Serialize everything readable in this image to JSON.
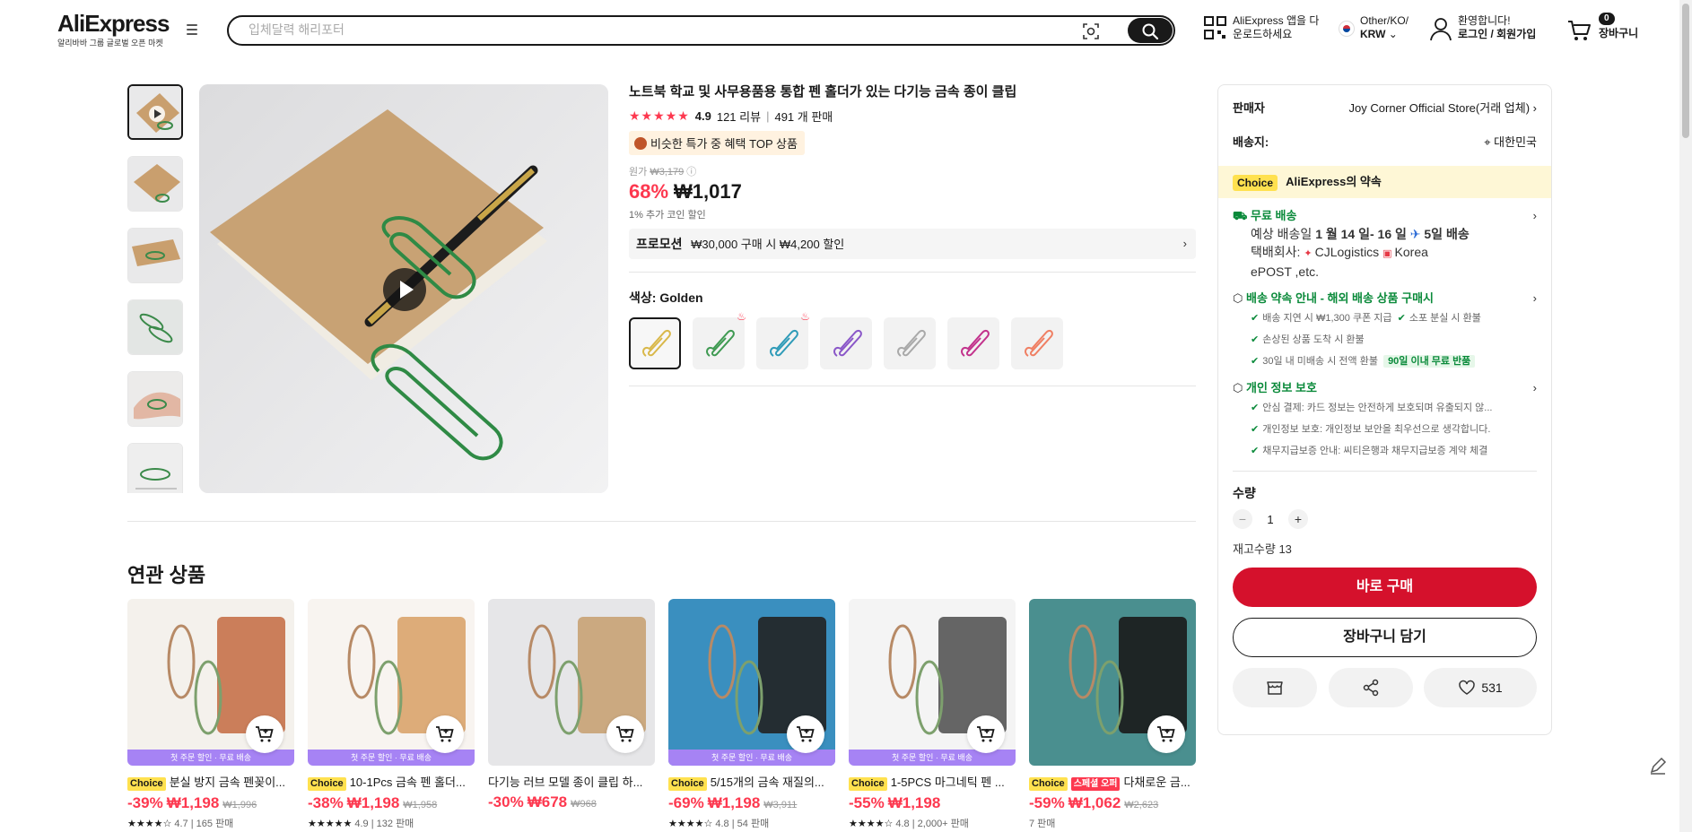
{
  "header": {
    "logo": "AliExpress",
    "logo_sub": "알리바바 그룹 글로벌 오픈 마켓",
    "search_placeholder": "입체달력 해리포터",
    "app_line1": "AliExpress 앱을 다",
    "app_line2": "운로드하세요",
    "region_line1": "Other/KO/",
    "region_line2": "KRW",
    "account_line1": "환영합니다!",
    "account_line2": "로그인 / 회원가입",
    "cart_count": "0",
    "cart_label": "장바구니"
  },
  "product": {
    "title": "노트북 학교 및 사무용품용 통합 펜 홀더가 있는 다기능 금속 종이 클립",
    "rating": "4.9",
    "reviews": "121 리뷰",
    "sold": "491 개 판매",
    "deal_badge": "비슷한 특가 중 혜택 TOP 상품",
    "orig_label": "원가",
    "orig_price": "₩3,179",
    "discount": "68%",
    "price": "₩1,017",
    "coin_discount": "1% 추가 코인 할인",
    "promo_label": "프로모션",
    "promo_text": "₩30,000 구매 시 ₩4,200 할인",
    "color_label": "색상:",
    "color_value": "Golden",
    "swatch_colors": [
      "#d9b84a",
      "#3f9a52",
      "#2f9bb8",
      "#8a57c8",
      "#a9a9a9",
      "#c2328c",
      "#ef7f63"
    ]
  },
  "panel": {
    "seller_label": "판매자",
    "seller_value": "Joy Corner Official Store(거래 업체)",
    "ship_to_label": "배송지:",
    "ship_to_value": "대한민국",
    "choice_tag": "Choice",
    "choice_text": "AliExpress의 약속",
    "free_ship": "무료 배송",
    "eta_prefix": "예상 배송일",
    "eta_range": "1 월 14 일- 16 일",
    "eta_fast": "5일 배송",
    "carrier_label": "택배회사:",
    "carrier_line1": "CJLogistics",
    "carrier_line2": "Korea",
    "carrier_line3": "ePOST ,etc.",
    "promise_head": "배송 약속 안내 - 해외 배송 상품 구매시",
    "promise_1": "배송 지연 시 ₩1,300 쿠폰 지급",
    "promise_2": "소포 분실 시 환불",
    "promise_3": "손상된 상품 도착 시 환불",
    "promise_4": "30일 내 미배송 시 전액 환불",
    "promise_4_badge": "90일 이내 무료 반품",
    "privacy_head": "개인 정보 보호",
    "privacy_1": "안심 결제: 카드 정보는 안전하게 보호되며 유출되지 않...",
    "privacy_2": "개인정보 보호: 개인정보 보안을 최우선으로 생각합니다.",
    "privacy_3": "채무지급보증 안내: 씨티은행과 채무지급보증 계약 체결",
    "qty_label": "수량",
    "qty_value": "1",
    "stock": "재고수량 13",
    "buy_now": "바로 구매",
    "add_cart": "장바구니 담기",
    "wish_count": "531"
  },
  "related": {
    "title": "연관 상품",
    "strip": "첫 주문 할인 · 무료 배송",
    "items": [
      {
        "tag": "Choice",
        "name": "분실 방지 금속 펜꽂이...",
        "discount": "-39%",
        "price": "₩1,198",
        "orig": "₩1,996",
        "stars": "★★★★☆",
        "rating": "4.7",
        "sold": "165 판매",
        "strip": true
      },
      {
        "tag": "Choice",
        "name": "10-1Pcs 금속 펜 홀더...",
        "discount": "-38%",
        "price": "₩1,198",
        "orig": "₩1,958",
        "stars": "★★★★★",
        "rating": "4.9",
        "sold": "132 판매",
        "strip": true
      },
      {
        "tag": "",
        "name": "다기능 러브 모델 종이 클립 하...",
        "discount": "-30%",
        "price": "₩678",
        "orig": "₩968",
        "stars": "",
        "rating": "",
        "sold": "",
        "strip": false
      },
      {
        "tag": "Choice",
        "name": "5/15개의 금속 재질의...",
        "discount": "-69%",
        "price": "₩1,198",
        "orig": "₩3,911",
        "stars": "★★★★☆",
        "rating": "4.8",
        "sold": "54 판매",
        "strip": true
      },
      {
        "tag": "Choice",
        "name": "1-5PCS 마그네틱 펜 ...",
        "discount": "-55%",
        "price": "₩1,198",
        "orig": "",
        "stars": "★★★★☆",
        "rating": "4.8",
        "sold": "2,000+ 판매",
        "strip": true
      },
      {
        "tag": "Choice",
        "super": "스페셜 오퍼",
        "name": "다채로운 금...",
        "discount": "-59%",
        "price": "₩1,062",
        "orig": "₩2,623",
        "stars": "",
        "rating": "",
        "sold": "7 판매",
        "strip": false
      }
    ]
  }
}
